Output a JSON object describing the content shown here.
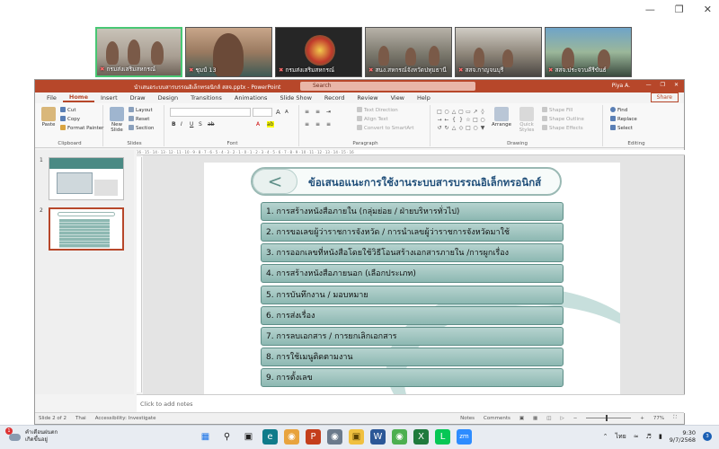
{
  "meeting": {
    "participants": [
      {
        "name": "กรมส่งเสริมสหกรณ์",
        "muted": true
      },
      {
        "name": "ชุมป์ 13",
        "muted": true
      },
      {
        "name": "กรมส่งเสริมสหกรณ์",
        "muted": true
      },
      {
        "name": "สนง.สหกรณ์จังหวัดปทุมธานี",
        "muted": true
      },
      {
        "name": "สสจ.กาญจนบุรี",
        "muted": true
      },
      {
        "name": "สสจ.ประจวบคีรีขันธ์",
        "muted": true
      }
    ]
  },
  "ppt": {
    "title": "นำเสนอระบบสารบรรณอิเล็กทรอนิกส์ สสจ.pptx  -  PowerPoint",
    "search_placeholder": "Search",
    "user": "Piya A.",
    "tabs": [
      "File",
      "Home",
      "Insert",
      "Draw",
      "Design",
      "Transitions",
      "Animations",
      "Slide Show",
      "Record",
      "Review",
      "View",
      "Help"
    ],
    "active_tab": "Home",
    "share_label": "Share",
    "ribbon": {
      "clipboard": {
        "paste": "Paste",
        "cut": "Cut",
        "copy": "Copy",
        "format_painter": "Format Painter",
        "label": "Clipboard"
      },
      "slides": {
        "new_slide": "New Slide",
        "layout": "Layout",
        "reset": "Reset",
        "section": "Section",
        "label": "Slides"
      },
      "font": {
        "label": "Font",
        "size_up": "A",
        "size_down": "A"
      },
      "paragraph": {
        "text_direction": "Text Direction",
        "align_text": "Align Text",
        "smartart": "Convert to SmartArt",
        "label": "Paragraph"
      },
      "drawing": {
        "arrange": "Arrange",
        "quick_styles": "Quick Styles",
        "shape_fill": "Shape Fill",
        "shape_outline": "Shape Outline",
        "shape_effects": "Shape Effects",
        "label": "Drawing"
      },
      "editing": {
        "find": "Find",
        "replace": "Replace",
        "select": "Select",
        "label": "Editing"
      }
    },
    "ruler_text": "16 · 15 · 14 · 13 · 12 · 11 · 10 · 9 · 8 · 7 · 6 · 5 · 4 · 3 · 2 · 1 · 0 · 1 · 2 · 3 · 4 · 5 · 6 · 7 · 8 · 9 · 10 · 11 · 12 · 13 · 14 · 15 · 16",
    "thumbnails": [
      {
        "num": "1"
      },
      {
        "num": "2"
      }
    ],
    "slide": {
      "title": "ข้อเสนอแนะการใช้งานระบบสารบรรณอิเล็กทรอนิกส์",
      "back_symbol": "<",
      "items": [
        "1. การสร้างหนังสือภายใน (กลุ่มย่อย / ฝ่ายบริหารทั่วไป)",
        "2. การขอเลขผู้ว่าราชการจังหวัด / การนำเลขผู้ว่าราชการจังหวัดมาใช้",
        "3. การออกเลขที่หนังสือโดยใช้วิธีโอนสร้างเอกสารภายใน /การผูกเรื่อง",
        "4. การสร้างหนังสือภายนอก (เลือกประเภท)",
        "5. การบันทึกงาน / มอบหมาย",
        "6. การส่งเรื่อง",
        "7. การลบเอกสาร / การยกเลิกเอกสาร",
        "8. การใช้เมนูติดตามงาน",
        "9. การตั้งเลข"
      ]
    },
    "notes_placeholder": "Click to add notes",
    "status": {
      "slide": "Slide 2 of 2",
      "language": "Thai",
      "accessibility": "Accessibility: Investigate",
      "notes": "Notes",
      "comments": "Comments",
      "zoom": "77%"
    }
  },
  "taskbar": {
    "weather_title": "คำเตือนฝนตก",
    "weather_sub": "เกิดขึ้นอยู่",
    "weather_badge": "1",
    "lang": "ไทย",
    "time": "9:30",
    "date": "9/7/2568",
    "notifications": "3"
  },
  "colors": {
    "ppt_accent": "#b7472a",
    "item_fill": "#8db8b2",
    "title_text": "#1f4e79"
  }
}
